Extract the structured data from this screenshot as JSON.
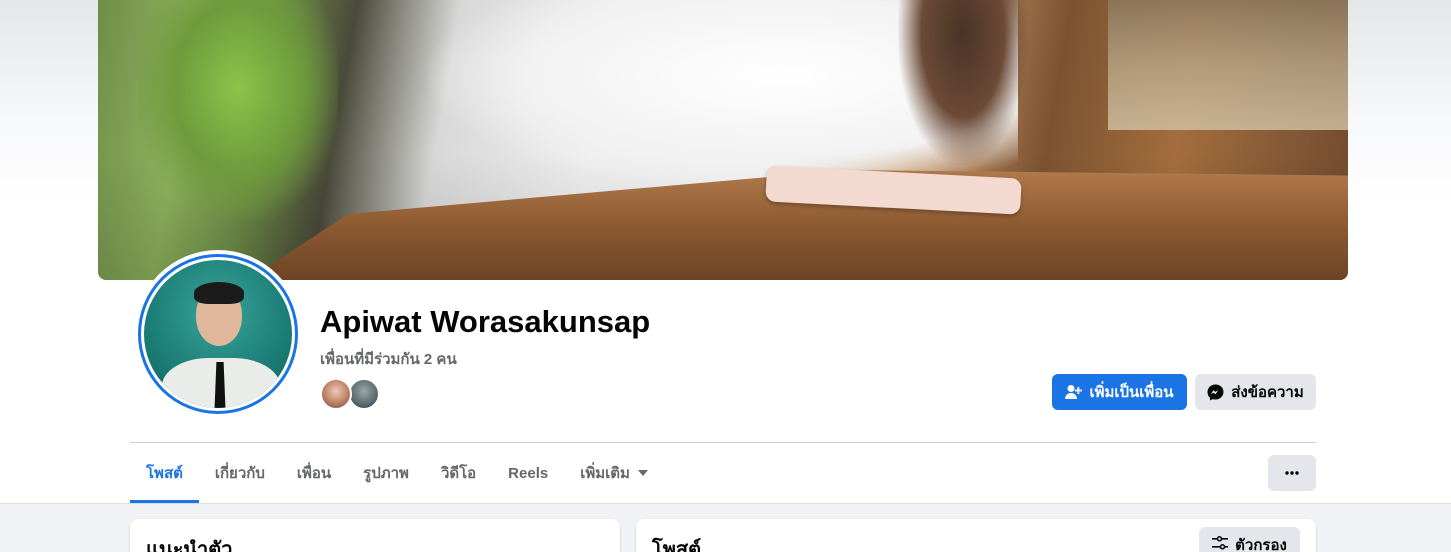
{
  "profile": {
    "name": "Apiwat Worasakunsap",
    "mutual_friends": "เพื่อนที่มีร่วมกัน 2 คน"
  },
  "actions": {
    "add_friend_label": "เพิ่มเป็นเพื่อน",
    "message_label": "ส่งข้อความ",
    "more_label": "···"
  },
  "tabs": [
    {
      "label": "โพสต์",
      "active": true
    },
    {
      "label": "เกี่ยวกับ",
      "active": false
    },
    {
      "label": "เพื่อน",
      "active": false
    },
    {
      "label": "รูปภาพ",
      "active": false
    },
    {
      "label": "วิดีโอ",
      "active": false
    },
    {
      "label": "Reels",
      "active": false
    },
    {
      "label": "เพิ่มเติม",
      "active": false
    }
  ],
  "intro_card": {
    "title": "แนะนำตัว"
  },
  "posts_card": {
    "title": "โพสต์",
    "filter_label": "ตัวกรอง"
  },
  "icons": {
    "add_friend": "person-add-icon",
    "message": "messenger-icon",
    "more": "ellipsis-icon",
    "dropdown": "caret-down-icon",
    "filter": "sliders-icon"
  },
  "colors": {
    "accent": "#1b74e4",
    "secondary_button": "#e4e6eb",
    "muted_text": "#65676b",
    "page_bg": "#f0f2f5"
  }
}
